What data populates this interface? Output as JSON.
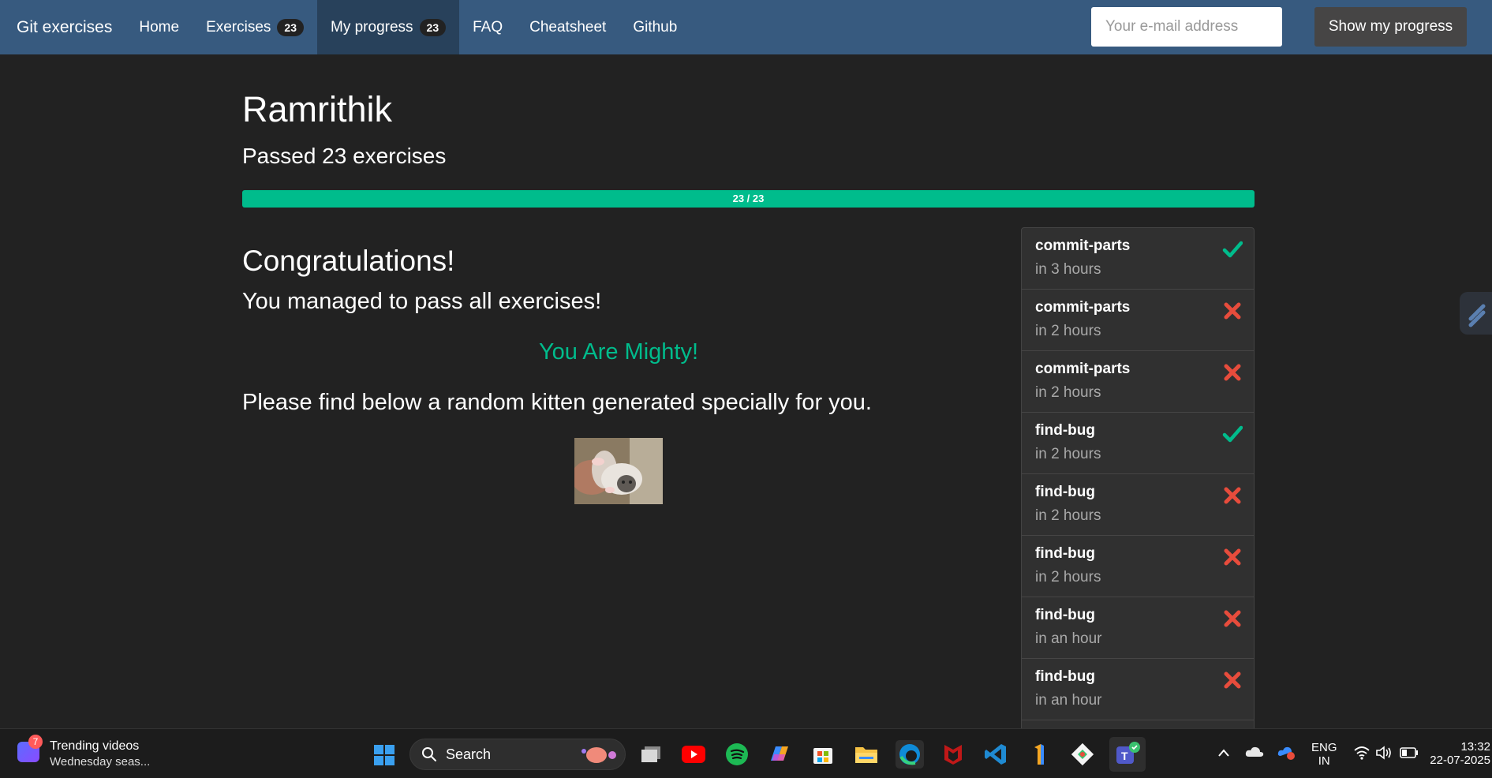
{
  "navbar": {
    "brand": "Git exercises",
    "items": [
      {
        "label": "Home"
      },
      {
        "label": "Exercises",
        "badge": "23"
      },
      {
        "label": "My progress",
        "badge": "23",
        "active": true
      },
      {
        "label": "FAQ"
      },
      {
        "label": "Cheatsheet"
      },
      {
        "label": "Github"
      }
    ],
    "email_placeholder": "Your e-mail address",
    "email_value": "",
    "show_progress_label": "Show my progress"
  },
  "main": {
    "username": "Ramrithik",
    "passed_text": "Passed 23 exercises",
    "progress": {
      "label": "23 / 23",
      "fraction": 1.0
    },
    "congrats_title": "Congratulations!",
    "managed_text": "You managed to pass all exercises!",
    "mighty_text": "You Are Mighty!",
    "kitten_text": "Please find below a random kitten generated specially for you."
  },
  "attempts": [
    {
      "exercise": "commit-parts",
      "time": "in 3 hours",
      "status": "passed"
    },
    {
      "exercise": "commit-parts",
      "time": "in 2 hours",
      "status": "failed"
    },
    {
      "exercise": "commit-parts",
      "time": "in 2 hours",
      "status": "failed"
    },
    {
      "exercise": "find-bug",
      "time": "in 2 hours",
      "status": "passed"
    },
    {
      "exercise": "find-bug",
      "time": "in 2 hours",
      "status": "failed"
    },
    {
      "exercise": "find-bug",
      "time": "in 2 hours",
      "status": "failed"
    },
    {
      "exercise": "find-bug",
      "time": "in an hour",
      "status": "failed"
    },
    {
      "exercise": "find-bug",
      "time": "in an hour",
      "status": "failed"
    }
  ],
  "colors": {
    "navbar": "#375a7f",
    "background": "#222222",
    "success": "#00bc8c",
    "danger": "#e74c3c"
  },
  "taskbar": {
    "news_count": "7",
    "news_title": "Trending videos",
    "news_subtitle": "Wednesday seas...",
    "search_label": "Search",
    "apps": [
      "task-view-icon",
      "youtube-icon",
      "spotify-icon",
      "copilot-icon",
      "store-icon",
      "file-explorer-icon",
      "edge-icon",
      "mcafee-icon",
      "vscode-icon",
      "app-icon",
      "git-icon",
      "teams-icon"
    ],
    "lang_line1": "ENG",
    "lang_line2": "IN",
    "time": "13:32",
    "date": "22-07-2025"
  }
}
